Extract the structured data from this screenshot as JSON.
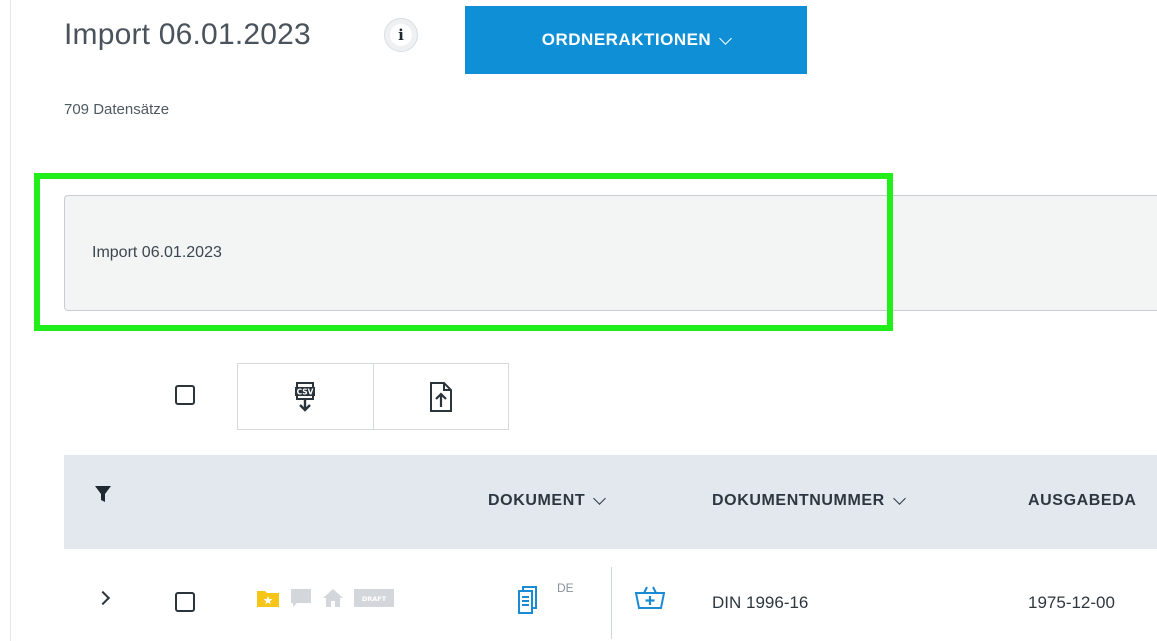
{
  "header": {
    "title": "Import 06.01.2023",
    "info_icon": "info-icon",
    "actions_button_label": "ORDNERAKTIONEN",
    "record_count": "709 Datensätze"
  },
  "name_field": {
    "value": "Import 06.01.2023"
  },
  "toolbar": {
    "csv_export_icon": "csv-export-icon",
    "upload_icon": "upload-file-icon"
  },
  "table": {
    "columns": [
      "DOKUMENT",
      "DOKUMENTNUMMER",
      "AUSGABEDA"
    ],
    "rows": [
      {
        "language": "DE",
        "document_number": "DIN 1996-16",
        "date": "1975-12-00",
        "draft_badge": "DRAFT"
      }
    ]
  },
  "colors": {
    "accent": "#0f8fd6",
    "highlight": "#22ee1a",
    "header_bg": "#e3e8ee",
    "folder_yellow": "#f5c518",
    "icon_blue": "#1a8ad4",
    "icon_gray": "#d3d7db"
  }
}
